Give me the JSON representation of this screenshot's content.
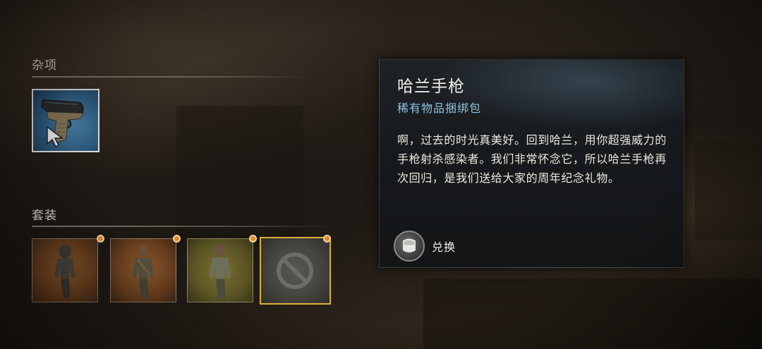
{
  "sections": {
    "misc": {
      "title": "杂项",
      "item": {
        "icon": "pistol-icon",
        "selected": true
      }
    },
    "outfits": {
      "title": "套装",
      "items": [
        {
          "icon": "hooded-survivor-outfit-icon",
          "new": true,
          "bg_color": "#7a4d25"
        },
        {
          "icon": "jacket-survivor-outfit-icon",
          "new": true,
          "bg_color": "#7a4d25"
        },
        {
          "icon": "green-shirt-outfit-icon",
          "new": true,
          "bg_color": "#6a6128"
        },
        {
          "icon": "unavailable-icon",
          "new": true,
          "highlighted": true,
          "bg_color": "#4a4845"
        }
      ]
    }
  },
  "tooltip": {
    "title": "哈兰手枪",
    "subtitle": "稀有物品捆绑包",
    "description": "啊，过去的时光真美好。回到哈兰，用你超强威力的手枪射杀感染者。我们非常怀念它，所以哈兰手枪再次回归，是我们送给大家的周年纪念礼物。",
    "action": {
      "icon": "gamepad-button-icon",
      "label": "兑换"
    }
  },
  "colors": {
    "subtitle_accent": "#8fc0e0",
    "new_badge": "#e08a2c",
    "highlight_border": "#d8b13b",
    "selected_border": "#e8e6e2"
  }
}
